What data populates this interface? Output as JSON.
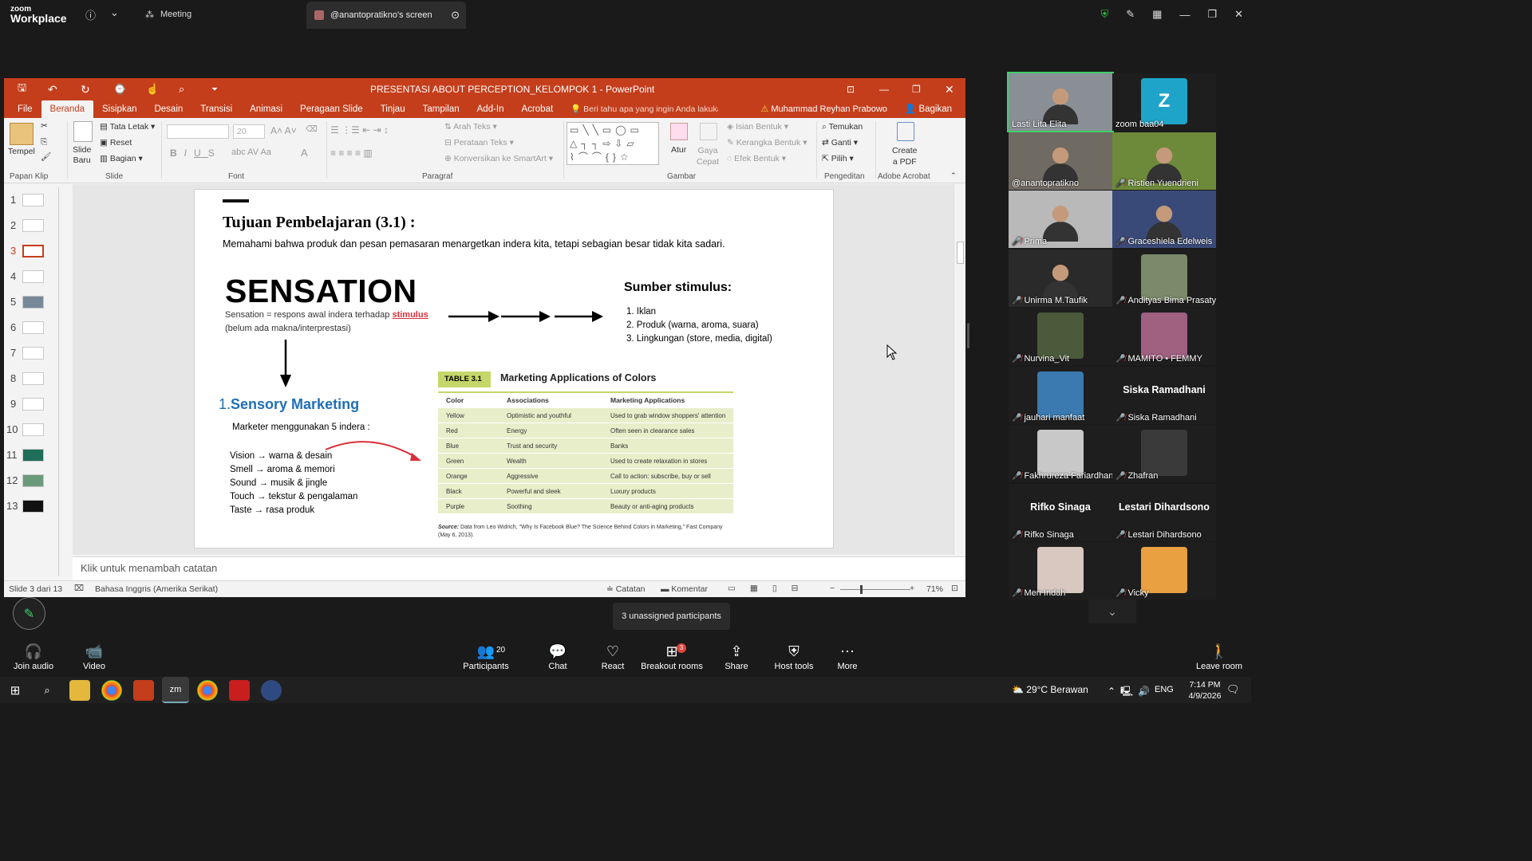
{
  "zoom": {
    "brand_top": "zoom",
    "brand_bottom": "Workplace",
    "meeting_tab": "Meeting",
    "screen_tab": "@anantopratikno's screen",
    "unassigned": "3 unassigned participants",
    "toolbar": [
      {
        "label": "Join audio",
        "icon": "headphone-icon",
        "ic": "🎧"
      },
      {
        "label": "Video",
        "icon": "video-off-icon",
        "ic": "📹"
      },
      {
        "label": "Participants",
        "icon": "participants-icon",
        "ic": "👥",
        "count": "20"
      },
      {
        "label": "Chat",
        "icon": "chat-icon",
        "ic": "💬"
      },
      {
        "label": "React",
        "icon": "heart-icon",
        "ic": "♡"
      },
      {
        "label": "Breakout rooms",
        "icon": "breakout-icon",
        "ic": "⊞",
        "badge": "3"
      },
      {
        "label": "Share",
        "icon": "share-icon",
        "ic": "⇪"
      },
      {
        "label": "Host tools",
        "icon": "shield-icon",
        "ic": "⛨"
      },
      {
        "label": "More",
        "icon": "more-icon",
        "ic": "⋯"
      },
      {
        "label": "Leave room",
        "icon": "leave-icon",
        "ic": "🚶"
      }
    ]
  },
  "ppt": {
    "title": "PRESENTASI ABOUT PERCEPTION_KELOMPOK 1 - PowerPoint",
    "tabs": [
      "File",
      "Beranda",
      "Sisipkan",
      "Desain",
      "Transisi",
      "Animasi",
      "Peragaan Slide",
      "Tinjau",
      "Tampilan",
      "Add-In",
      "Acrobat"
    ],
    "tell_me": "Beri tahu apa yang ingin Anda lakukan",
    "user": "Muhammad Reyhan Prabowo",
    "share": "Bagikan",
    "ribbon": {
      "tempel": "Tempel",
      "papan_klip": "Papan Klip",
      "slide_baru": "Slide\nBaru",
      "tata_letak": "Tata Letak",
      "reset": "Reset",
      "bagian": "Bagian",
      "slide_grp": "Slide",
      "font_size": "20",
      "font_grp": "Font",
      "arah_teks": "Arah Teks",
      "perataan_teks": "Perataan Teks",
      "konversikan": "Konversikan ke SmartArt",
      "paragraf": "Paragraf",
      "atur": "Atur",
      "gaya_cepat": "Gaya\nCepat",
      "isian": "Isian Bentuk",
      "kerangka": "Kerangka Bentuk",
      "efek": "Efek Bentuk",
      "gambar": "Gambar",
      "temukan": "Temukan",
      "ganti": "Ganti",
      "pilih": "Pilih",
      "pengeditan": "Pengeditan",
      "create_pdf": "Create\na PDF",
      "adobe": "Adobe Acrobat"
    },
    "thumbnails": [
      "1",
      "2",
      "3",
      "4",
      "5",
      "6",
      "7",
      "8",
      "9",
      "10",
      "11",
      "12",
      "13"
    ],
    "notes_placeholder": "Klik untuk menambah catatan",
    "status": {
      "slide": "Slide 3 dari 13",
      "lang": "Bahasa Inggris (Amerika Serikat)",
      "catatan": "Catatan",
      "komentar": "Komentar",
      "zoom": "71%"
    }
  },
  "slide": {
    "heading": "Tujuan Pembelajaran (3.1) :",
    "intro": "Memahami bahwa produk dan pesan pemasaran menargetkan indera kita, tetapi sebagian besar tidak kita sadari.",
    "sensation": "SENSATION",
    "sens_def_a": "Sensation = respons awal indera terhadap ",
    "sens_def_link": "stimulus",
    "sens_def_b": "(belum ada makna/interprestasi)",
    "sumber_title": "Sumber stimulus:",
    "sumber_items": [
      "1. Iklan",
      "2. Produk (warna, aroma, suara)",
      "3. Lingkungan (store, media, digital)"
    ],
    "sensory_num": "1.",
    "sensory_title": "Sensory Marketing",
    "marketer": "Marketer menggunakan 5 indera :",
    "senses": [
      "Vision → warna & desain",
      "Smell → aroma & memori",
      "Sound → musik & jingle",
      "Touch → tekstur & pengalaman",
      "Taste → rasa produk"
    ],
    "table_tag": "TABLE 3.1",
    "table_title": "Marketing Applications of Colors",
    "table_headers": [
      "Color",
      "Associations",
      "Marketing Applications"
    ],
    "table_rows": [
      [
        "Yellow",
        "Optimistic and youthful",
        "Used to grab window shoppers' attention"
      ],
      [
        "Red",
        "Energy",
        "Often seen in clearance sales"
      ],
      [
        "Blue",
        "Trust and security",
        "Banks"
      ],
      [
        "Green",
        "Wealth",
        "Used to create relaxation in stores"
      ],
      [
        "Orange",
        "Aggressive",
        "Call to action: subscribe, buy or sell"
      ],
      [
        "Black",
        "Powerful and sleek",
        "Luxury products"
      ],
      [
        "Purple",
        "Soothing",
        "Beauty or anti-aging products"
      ]
    ],
    "source_label": "Source:",
    "source_text": "Data from Leo Widrich, \"Why Is Facebook Blue? The Science Behind Colors in Marketing,\" Fast Company (May 6, 2013)."
  },
  "participants": [
    {
      "name": "Lasti Lita Elita",
      "muted": false,
      "kind": "video",
      "color": "#8a8f96",
      "active": true
    },
    {
      "name": "zoom baa04",
      "muted": false,
      "kind": "letter",
      "letter": "Z",
      "color": "#1fa4c9"
    },
    {
      "name": "@anantopratikno",
      "muted": false,
      "kind": "video",
      "color": "#6f6a62"
    },
    {
      "name": "Ristien Yuendrieni",
      "muted": true,
      "kind": "video",
      "color": "#6d8a3a"
    },
    {
      "name": "Prima",
      "muted": true,
      "kind": "video",
      "color": "#b9b9b9"
    },
    {
      "name": "Graceshiela Edelweis",
      "muted": true,
      "kind": "video",
      "color": "#3a4a78"
    },
    {
      "name": "Unirma M.Taufik",
      "muted": true,
      "kind": "video",
      "color": "#2a2a2a"
    },
    {
      "name": "Andityas Bima Prasatya",
      "muted": true,
      "kind": "photo",
      "color": "#7a8a6a"
    },
    {
      "name": "Nurvina_Vit",
      "muted": true,
      "kind": "photo",
      "color": "#4a5a3a"
    },
    {
      "name": "MAMITO • FEMMY",
      "muted": true,
      "kind": "photo",
      "color": "#a06080"
    },
    {
      "name": "jauhari manfaat",
      "muted": true,
      "kind": "photo",
      "color": "#3a7ab0"
    },
    {
      "name": "Siska Ramadhani",
      "muted": true,
      "kind": "name",
      "big": "Siska Ramadhani"
    },
    {
      "name": "Fakhrureza Fariardhany",
      "muted": true,
      "kind": "photo",
      "color": "#c8c8c8"
    },
    {
      "name": "Zhafran",
      "muted": true,
      "kind": "photo",
      "color": "#3a3a3a"
    },
    {
      "name": "Rifko Sinaga",
      "muted": true,
      "kind": "name",
      "big": "Rifko Sinaga"
    },
    {
      "name": "Lestari Dihardsono",
      "muted": true,
      "kind": "name",
      "big": "Lestari Dihardsono"
    },
    {
      "name": "Meri Indah",
      "muted": true,
      "kind": "photo",
      "color": "#d8c8c0"
    },
    {
      "name": "Vicky",
      "muted": true,
      "kind": "photo",
      "color": "#e8a040"
    }
  ],
  "taskbar": {
    "weather": "29°C  Berawan",
    "lang": "ENG",
    "time": "7:14 PM",
    "date": "4/9/2026"
  }
}
